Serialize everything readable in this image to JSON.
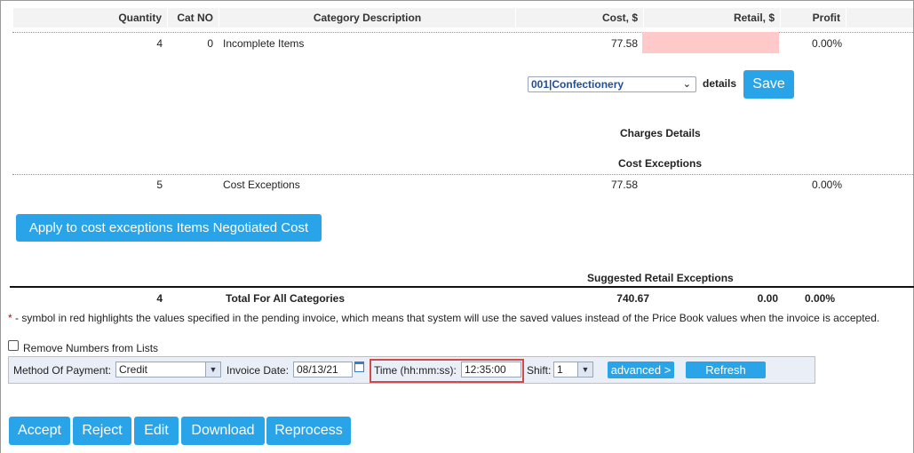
{
  "table": {
    "headers": {
      "quantity": "Quantity",
      "cat_no": "Cat NO",
      "category_description": "Category Description",
      "cost": "Cost, $",
      "retail": "Retail, $",
      "profit": "Profit"
    },
    "incomplete_row": {
      "quantity": "4",
      "cat_no": "0",
      "description": "Incomplete Items",
      "cost": "77.58",
      "retail": "",
      "profit": "0.00%"
    },
    "category_select": {
      "value": "001|Confectionery",
      "details_label": "details",
      "save_label": "Save"
    },
    "charges_details_title": "Charges Details",
    "cost_exceptions_title": "Cost Exceptions",
    "cost_exceptions_row": {
      "quantity": "5",
      "description": "Cost Exceptions",
      "cost": "77.58",
      "profit": "0.00%"
    },
    "apply_button_label": "Apply to cost exceptions Items Negotiated Cost",
    "suggested_retail_title": "Suggested Retail Exceptions",
    "total_row": {
      "quantity": "4",
      "description": "Total For All Categories",
      "cost": "740.67",
      "retail": "0.00",
      "profit": "0.00%"
    }
  },
  "note": {
    "asterisk": "*",
    "text": " - symbol in red highlights the values specified in the pending invoice, which means that system will use the saved values instead of the Price Book values when the invoice is accepted."
  },
  "remove_numbers_label": "Remove Numbers from Lists",
  "payment_bar": {
    "method_label": "Method Of Payment:",
    "method_value": "Credit",
    "invoice_date_label": "Invoice Date:",
    "invoice_date_value": "08/13/21",
    "time_label": "Time (hh:mm:ss):",
    "time_value": "12:35:00",
    "shift_label": "Shift:",
    "shift_value": "1",
    "advanced_label": "advanced >",
    "refresh_label": "Refresh"
  },
  "actions": {
    "accept": "Accept",
    "reject": "Reject",
    "edit": "Edit",
    "download": "Download",
    "reprocess": "Reprocess"
  },
  "colors": {
    "accent_blue": "#29a4e8",
    "retail_highlight": "#ffc9c9",
    "time_highlight_border": "#d04a4a"
  }
}
